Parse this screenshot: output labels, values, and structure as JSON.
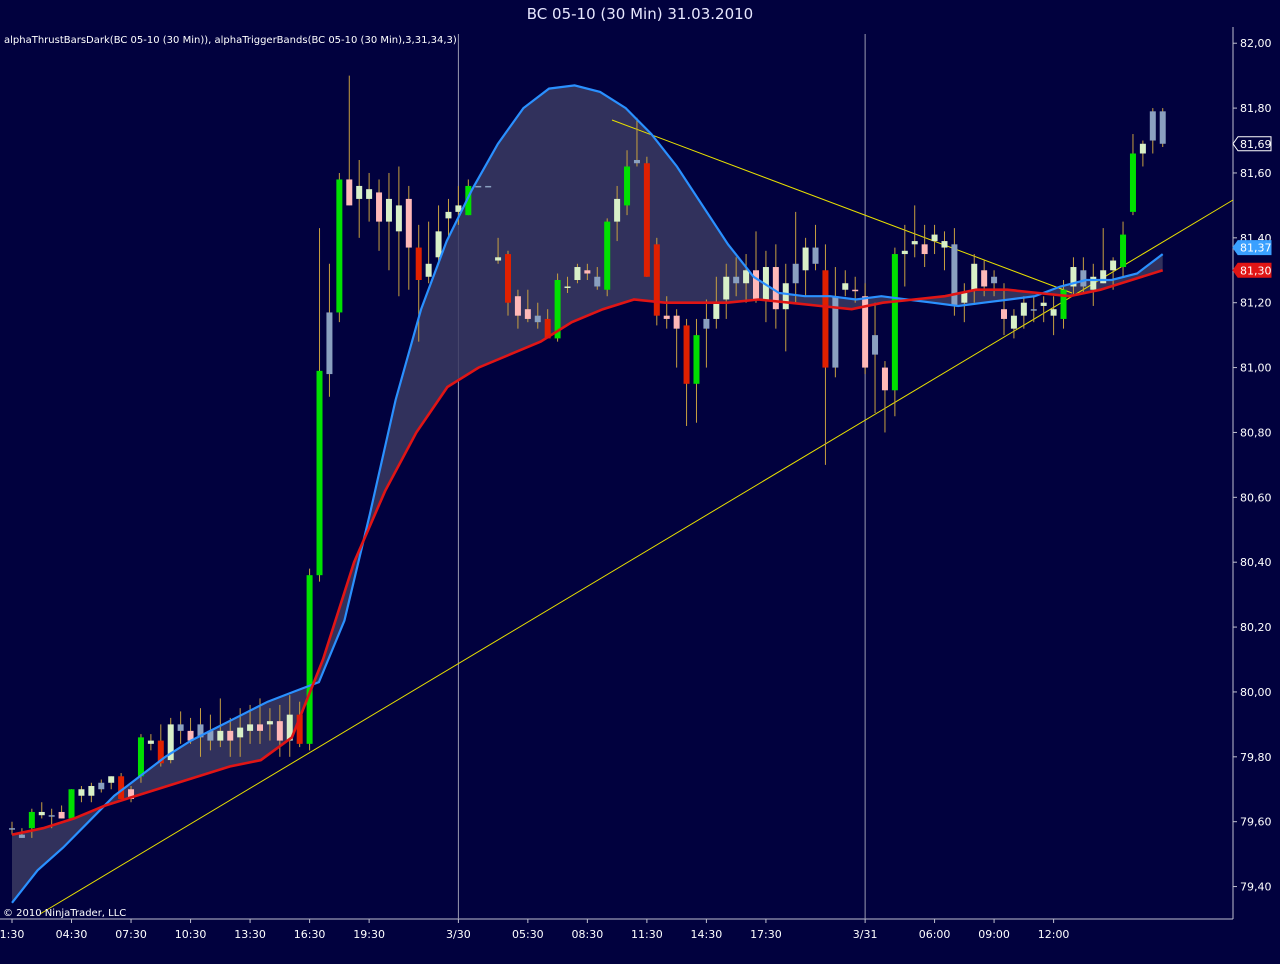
{
  "window": {
    "title": "BC 05-10 (30 Min)  31.03.2010"
  },
  "chart_data": {
    "type": "candlestick",
    "indicator_label": "alphaThrustBarsDark(BC 05-10 (30 Min)), alphaTriggerBands(BC 05-10 (30 Min),3,31,34,3)",
    "copyright": "© 2010 NinjaTrader, LLC",
    "ylim": [
      79.3,
      82.05
    ],
    "y_ticks": [
      "82,00",
      "81,80",
      "81,60",
      "81,40",
      "81,20",
      "81,00",
      "80,80",
      "80,60",
      "80,40",
      "80,20",
      "80,00",
      "79,80",
      "79,60",
      "79,40"
    ],
    "x_ticks": [
      {
        "label": "1:30",
        "bar": 0
      },
      {
        "label": "04:30",
        "bar": 6
      },
      {
        "label": "07:30",
        "bar": 12
      },
      {
        "label": "10:30",
        "bar": 18
      },
      {
        "label": "13:30",
        "bar": 24
      },
      {
        "label": "16:30",
        "bar": 30
      },
      {
        "label": "19:30",
        "bar": 36
      },
      {
        "label": "3/30",
        "bar": 45
      },
      {
        "label": "05:30",
        "bar": 52
      },
      {
        "label": "08:30",
        "bar": 58
      },
      {
        "label": "11:30",
        "bar": 64
      },
      {
        "label": "14:30",
        "bar": 70
      },
      {
        "label": "17:30",
        "bar": 76
      },
      {
        "label": "3/31",
        "bar": 86
      },
      {
        "label": "06:00",
        "bar": 93
      },
      {
        "label": "09:00",
        "bar": 99
      },
      {
        "label": "12:00",
        "bar": 105
      }
    ],
    "session_dividers": [
      45,
      86
    ],
    "price_tags": [
      {
        "label": "81,69",
        "value": 81.69,
        "style": "last"
      },
      {
        "label": "81,37",
        "value": 81.37,
        "style": "blue"
      },
      {
        "label": "81,30",
        "value": 81.3,
        "style": "red"
      }
    ],
    "colors": {
      "background": "#01013e",
      "bull_strong": "#00e000",
      "bull": "#d8f0c8",
      "bear_strong": "#e02000",
      "bear": "#ffb8b8",
      "neutral": "#8aa0c0",
      "wick": "#c8a040",
      "upper_band": "#2a90ff",
      "lower_band": "#e01515",
      "band_fill": "#3a3a62",
      "trendline": "#e8e000",
      "divider": "#9a9ab0"
    },
    "bars": [
      {
        "o": 79.58,
        "h": 79.6,
        "l": 79.56,
        "c": 79.58,
        "s": "n"
      },
      {
        "o": 79.55,
        "h": 79.58,
        "l": 79.55,
        "c": 79.56,
        "s": "n"
      },
      {
        "o": 79.58,
        "h": 79.64,
        "l": 79.55,
        "c": 79.63,
        "s": "gs"
      },
      {
        "o": 79.62,
        "h": 79.66,
        "l": 79.61,
        "c": 79.63,
        "s": "g"
      },
      {
        "o": 79.62,
        "h": 79.64,
        "l": 79.58,
        "c": 79.62,
        "s": "n"
      },
      {
        "o": 79.63,
        "h": 79.65,
        "l": 79.61,
        "c": 79.61,
        "s": "r"
      },
      {
        "o": 79.61,
        "h": 79.7,
        "l": 79.61,
        "c": 79.7,
        "s": "gs"
      },
      {
        "o": 79.68,
        "h": 79.71,
        "l": 79.66,
        "c": 79.7,
        "s": "g"
      },
      {
        "o": 79.68,
        "h": 79.72,
        "l": 79.66,
        "c": 79.71,
        "s": "g"
      },
      {
        "o": 79.7,
        "h": 79.73,
        "l": 79.69,
        "c": 79.72,
        "s": "n"
      },
      {
        "o": 79.72,
        "h": 79.74,
        "l": 79.7,
        "c": 79.74,
        "s": "g"
      },
      {
        "o": 79.74,
        "h": 79.75,
        "l": 79.67,
        "c": 79.67,
        "s": "rs"
      },
      {
        "o": 79.7,
        "h": 79.71,
        "l": 79.66,
        "c": 79.67,
        "s": "r"
      },
      {
        "o": 79.74,
        "h": 79.87,
        "l": 79.72,
        "c": 79.86,
        "s": "gs"
      },
      {
        "o": 79.84,
        "h": 79.87,
        "l": 79.82,
        "c": 79.85,
        "s": "g"
      },
      {
        "o": 79.85,
        "h": 79.9,
        "l": 79.77,
        "c": 79.78,
        "s": "rs"
      },
      {
        "o": 79.79,
        "h": 79.92,
        "l": 79.78,
        "c": 79.9,
        "s": "g"
      },
      {
        "o": 79.9,
        "h": 79.94,
        "l": 79.84,
        "c": 79.88,
        "s": "n"
      },
      {
        "o": 79.88,
        "h": 79.92,
        "l": 79.84,
        "c": 79.85,
        "s": "r"
      },
      {
        "o": 79.86,
        "h": 79.95,
        "l": 79.8,
        "c": 79.9,
        "s": "n"
      },
      {
        "o": 79.88,
        "h": 79.93,
        "l": 79.82,
        "c": 79.85,
        "s": "n"
      },
      {
        "o": 79.85,
        "h": 79.98,
        "l": 79.83,
        "c": 79.88,
        "s": "g"
      },
      {
        "o": 79.88,
        "h": 79.92,
        "l": 79.8,
        "c": 79.85,
        "s": "r"
      },
      {
        "o": 79.86,
        "h": 79.95,
        "l": 79.8,
        "c": 79.89,
        "s": "g"
      },
      {
        "o": 79.88,
        "h": 79.96,
        "l": 79.84,
        "c": 79.9,
        "s": "g"
      },
      {
        "o": 79.88,
        "h": 79.98,
        "l": 79.84,
        "c": 79.9,
        "s": "r"
      },
      {
        "o": 79.9,
        "h": 79.95,
        "l": 79.85,
        "c": 79.91,
        "s": "g"
      },
      {
        "o": 79.91,
        "h": 79.96,
        "l": 79.8,
        "c": 79.85,
        "s": "r"
      },
      {
        "o": 79.85,
        "h": 79.99,
        "l": 79.8,
        "c": 79.93,
        "s": "g"
      },
      {
        "o": 79.93,
        "h": 79.97,
        "l": 79.83,
        "c": 79.84,
        "s": "rs"
      },
      {
        "o": 79.84,
        "h": 80.38,
        "l": 79.82,
        "c": 80.36,
        "s": "gs"
      },
      {
        "o": 80.36,
        "h": 81.43,
        "l": 80.34,
        "c": 80.99,
        "s": "gs"
      },
      {
        "o": 80.98,
        "h": 81.32,
        "l": 80.91,
        "c": 81.17,
        "s": "n"
      },
      {
        "o": 81.17,
        "h": 81.6,
        "l": 81.14,
        "c": 81.58,
        "s": "gs"
      },
      {
        "o": 81.58,
        "h": 81.9,
        "l": 81.5,
        "c": 81.5,
        "s": "r"
      },
      {
        "o": 81.52,
        "h": 81.64,
        "l": 81.4,
        "c": 81.56,
        "s": "g"
      },
      {
        "o": 81.55,
        "h": 81.6,
        "l": 81.45,
        "c": 81.52,
        "s": "g"
      },
      {
        "o": 81.54,
        "h": 81.58,
        "l": 81.36,
        "c": 81.45,
        "s": "r"
      },
      {
        "o": 81.45,
        "h": 81.6,
        "l": 81.3,
        "c": 81.52,
        "s": "g"
      },
      {
        "o": 81.5,
        "h": 81.62,
        "l": 81.22,
        "c": 81.42,
        "s": "g"
      },
      {
        "o": 81.52,
        "h": 81.56,
        "l": 81.24,
        "c": 81.37,
        "s": "r"
      },
      {
        "o": 81.37,
        "h": 81.44,
        "l": 81.08,
        "c": 81.27,
        "s": "rs"
      },
      {
        "o": 81.28,
        "h": 81.45,
        "l": 81.26,
        "c": 81.32,
        "s": "g"
      },
      {
        "o": 81.34,
        "h": 81.5,
        "l": 81.32,
        "c": 81.42,
        "s": "g"
      },
      {
        "o": 81.46,
        "h": 81.52,
        "l": 81.4,
        "c": 81.48,
        "s": "g"
      },
      {
        "o": 81.48,
        "h": 81.56,
        "l": 81.44,
        "c": 81.5,
        "s": "g"
      },
      {
        "o": 81.47,
        "h": 81.58,
        "l": 81.47,
        "c": 81.56,
        "s": "gs"
      },
      {
        "o": 81.56,
        "h": 81.56,
        "l": 81.56,
        "c": 81.56,
        "s": "n"
      },
      {
        "o": 81.56,
        "h": 81.56,
        "l": 81.56,
        "c": 81.56,
        "s": "n"
      },
      {
        "o": 81.34,
        "h": 81.4,
        "l": 81.32,
        "c": 81.33,
        "s": "g"
      },
      {
        "o": 81.35,
        "h": 81.36,
        "l": 81.16,
        "c": 81.2,
        "s": "rs"
      },
      {
        "o": 81.22,
        "h": 81.24,
        "l": 81.12,
        "c": 81.16,
        "s": "r"
      },
      {
        "o": 81.18,
        "h": 81.24,
        "l": 81.14,
        "c": 81.15,
        "s": "r"
      },
      {
        "o": 81.16,
        "h": 81.2,
        "l": 81.12,
        "c": 81.14,
        "s": "n"
      },
      {
        "o": 81.15,
        "h": 81.18,
        "l": 81.09,
        "c": 81.09,
        "s": "rs"
      },
      {
        "o": 81.09,
        "h": 81.29,
        "l": 81.08,
        "c": 81.27,
        "s": "gs"
      },
      {
        "o": 81.25,
        "h": 81.28,
        "l": 81.23,
        "c": 81.25,
        "s": "g"
      },
      {
        "o": 81.27,
        "h": 81.32,
        "l": 81.26,
        "c": 81.31,
        "s": "g"
      },
      {
        "o": 81.3,
        "h": 81.32,
        "l": 81.27,
        "c": 81.29,
        "s": "r"
      },
      {
        "o": 81.28,
        "h": 81.31,
        "l": 81.24,
        "c": 81.25,
        "s": "n"
      },
      {
        "o": 81.24,
        "h": 81.46,
        "l": 81.22,
        "c": 81.45,
        "s": "gs"
      },
      {
        "o": 81.45,
        "h": 81.56,
        "l": 81.39,
        "c": 81.52,
        "s": "g"
      },
      {
        "o": 81.5,
        "h": 81.67,
        "l": 81.47,
        "c": 81.62,
        "s": "gs"
      },
      {
        "o": 81.63,
        "h": 81.77,
        "l": 81.62,
        "c": 81.64,
        "s": "n"
      },
      {
        "o": 81.63,
        "h": 81.65,
        "l": 81.28,
        "c": 81.28,
        "s": "rs"
      },
      {
        "o": 81.38,
        "h": 81.4,
        "l": 81.13,
        "c": 81.16,
        "s": "rs"
      },
      {
        "o": 81.16,
        "h": 81.22,
        "l": 81.12,
        "c": 81.15,
        "s": "r"
      },
      {
        "o": 81.16,
        "h": 81.18,
        "l": 81.0,
        "c": 81.12,
        "s": "r"
      },
      {
        "o": 81.13,
        "h": 81.15,
        "l": 80.82,
        "c": 80.95,
        "s": "rs"
      },
      {
        "o": 80.95,
        "h": 81.15,
        "l": 80.83,
        "c": 81.1,
        "s": "gs"
      },
      {
        "o": 81.12,
        "h": 81.21,
        "l": 81.0,
        "c": 81.15,
        "s": "n"
      },
      {
        "o": 81.15,
        "h": 81.28,
        "l": 81.12,
        "c": 81.2,
        "s": "g"
      },
      {
        "o": 81.21,
        "h": 81.32,
        "l": 81.15,
        "c": 81.28,
        "s": "g"
      },
      {
        "o": 81.28,
        "h": 81.34,
        "l": 81.22,
        "c": 81.26,
        "s": "n"
      },
      {
        "o": 81.26,
        "h": 81.35,
        "l": 81.2,
        "c": 81.3,
        "s": "g"
      },
      {
        "o": 81.3,
        "h": 81.42,
        "l": 81.2,
        "c": 81.21,
        "s": "r"
      },
      {
        "o": 81.21,
        "h": 81.36,
        "l": 81.14,
        "c": 81.31,
        "s": "g"
      },
      {
        "o": 81.31,
        "h": 81.38,
        "l": 81.12,
        "c": 81.18,
        "s": "r"
      },
      {
        "o": 81.18,
        "h": 81.32,
        "l": 81.05,
        "c": 81.26,
        "s": "g"
      },
      {
        "o": 81.26,
        "h": 81.48,
        "l": 81.2,
        "c": 81.32,
        "s": "n"
      },
      {
        "o": 81.3,
        "h": 81.4,
        "l": 81.22,
        "c": 81.37,
        "s": "g"
      },
      {
        "o": 81.37,
        "h": 81.44,
        "l": 81.3,
        "c": 81.32,
        "s": "n"
      },
      {
        "o": 81.3,
        "h": 81.38,
        "l": 80.7,
        "c": 81.0,
        "s": "rs"
      },
      {
        "o": 81.0,
        "h": 81.31,
        "l": 80.97,
        "c": 81.22,
        "s": "n"
      },
      {
        "o": 81.24,
        "h": 81.3,
        "l": 81.22,
        "c": 81.26,
        "s": "g"
      },
      {
        "o": 81.24,
        "h": 81.28,
        "l": 81.2,
        "c": 81.24,
        "s": "r"
      },
      {
        "o": 81.22,
        "h": 81.26,
        "l": 80.98,
        "c": 81.0,
        "s": "r"
      },
      {
        "o": 81.04,
        "h": 81.2,
        "l": 80.86,
        "c": 81.1,
        "s": "n"
      },
      {
        "o": 81.0,
        "h": 81.02,
        "l": 80.8,
        "c": 80.93,
        "s": "r"
      },
      {
        "o": 80.93,
        "h": 81.37,
        "l": 80.85,
        "c": 81.35,
        "s": "gs"
      },
      {
        "o": 81.35,
        "h": 81.44,
        "l": 81.25,
        "c": 81.36,
        "s": "g"
      },
      {
        "o": 81.38,
        "h": 81.5,
        "l": 81.34,
        "c": 81.39,
        "s": "g"
      },
      {
        "o": 81.38,
        "h": 81.44,
        "l": 81.31,
        "c": 81.35,
        "s": "r"
      },
      {
        "o": 81.39,
        "h": 81.44,
        "l": 81.35,
        "c": 81.41,
        "s": "g"
      },
      {
        "o": 81.37,
        "h": 81.42,
        "l": 81.3,
        "c": 81.39,
        "s": "g"
      },
      {
        "o": 81.38,
        "h": 81.43,
        "l": 81.16,
        "c": 81.19,
        "s": "n"
      },
      {
        "o": 81.2,
        "h": 81.26,
        "l": 81.14,
        "c": 81.23,
        "s": "g"
      },
      {
        "o": 81.24,
        "h": 81.35,
        "l": 81.2,
        "c": 81.32,
        "s": "g"
      },
      {
        "o": 81.3,
        "h": 81.33,
        "l": 81.22,
        "c": 81.25,
        "s": "r"
      },
      {
        "o": 81.26,
        "h": 81.3,
        "l": 81.22,
        "c": 81.28,
        "s": "n"
      },
      {
        "o": 81.18,
        "h": 81.26,
        "l": 81.1,
        "c": 81.15,
        "s": "r"
      },
      {
        "o": 81.12,
        "h": 81.18,
        "l": 81.09,
        "c": 81.16,
        "s": "g"
      },
      {
        "o": 81.16,
        "h": 81.22,
        "l": 81.12,
        "c": 81.2,
        "s": "g"
      },
      {
        "o": 81.18,
        "h": 81.22,
        "l": 81.14,
        "c": 81.18,
        "s": "n"
      },
      {
        "o": 81.19,
        "h": 81.22,
        "l": 81.14,
        "c": 81.2,
        "s": "g"
      },
      {
        "o": 81.16,
        "h": 81.22,
        "l": 81.1,
        "c": 81.18,
        "s": "g"
      },
      {
        "o": 81.15,
        "h": 81.27,
        "l": 81.12,
        "c": 81.24,
        "s": "gs"
      },
      {
        "o": 81.25,
        "h": 81.34,
        "l": 81.22,
        "c": 81.31,
        "s": "g"
      },
      {
        "o": 81.3,
        "h": 81.34,
        "l": 81.23,
        "c": 81.25,
        "s": "n"
      },
      {
        "o": 81.24,
        "h": 81.32,
        "l": 81.19,
        "c": 81.28,
        "s": "g"
      },
      {
        "o": 81.26,
        "h": 81.43,
        "l": 81.26,
        "c": 81.3,
        "s": "g"
      },
      {
        "o": 81.3,
        "h": 81.34,
        "l": 81.24,
        "c": 81.33,
        "s": "g"
      },
      {
        "o": 81.31,
        "h": 81.45,
        "l": 81.28,
        "c": 81.41,
        "s": "gs"
      },
      {
        "o": 81.48,
        "h": 81.72,
        "l": 81.47,
        "c": 81.66,
        "s": "gs"
      },
      {
        "o": 81.66,
        "h": 81.7,
        "l": 81.62,
        "c": 81.69,
        "s": "g"
      },
      {
        "o": 81.7,
        "h": 81.8,
        "l": 81.66,
        "c": 81.79,
        "s": "n"
      },
      {
        "o": 81.79,
        "h": 81.8,
        "l": 81.68,
        "c": 81.69,
        "s": "n"
      }
    ],
    "upper_band": [
      79.35,
      79.45,
      79.52,
      79.6,
      79.68,
      79.74,
      79.8,
      79.85,
      79.89,
      79.93,
      79.97,
      80.0,
      80.03,
      80.22,
      80.55,
      80.9,
      81.18,
      81.39,
      81.55,
      81.69,
      81.8,
      81.86,
      81.87,
      81.85,
      81.8,
      81.72,
      81.62,
      81.5,
      81.38,
      81.28,
      81.23,
      81.22,
      81.22,
      81.21,
      81.22,
      81.21,
      81.2,
      81.19,
      81.2,
      81.21,
      81.22,
      81.25,
      81.27,
      81.27,
      81.29,
      81.35
    ],
    "lower_band": [
      79.56,
      79.58,
      79.61,
      79.65,
      79.68,
      79.71,
      79.74,
      79.77,
      79.79,
      79.86,
      80.1,
      80.4,
      80.62,
      80.8,
      80.94,
      81.0,
      81.04,
      81.08,
      81.14,
      81.18,
      81.21,
      81.2,
      81.2,
      81.2,
      81.21,
      81.2,
      81.19,
      81.18,
      81.2,
      81.21,
      81.22,
      81.24,
      81.24,
      81.23,
      81.22,
      81.24,
      81.27,
      81.3
    ]
  }
}
